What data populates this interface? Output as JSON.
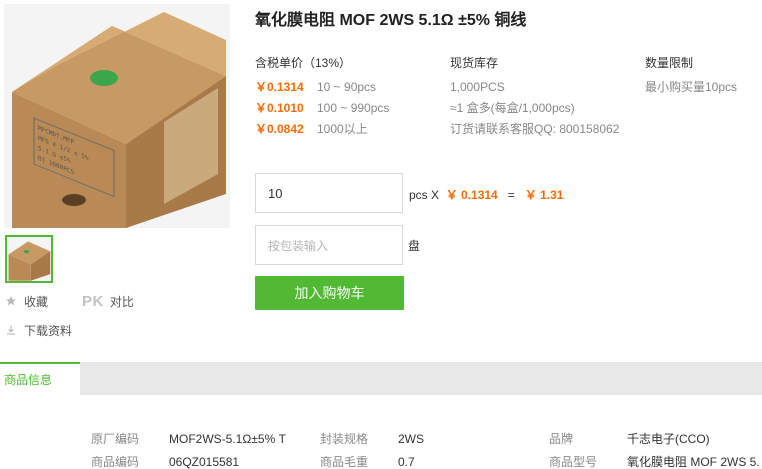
{
  "product": {
    "title": "氧化膜电阻 MOF 2WS 5.1Ω ±5% 铜线"
  },
  "price_col": {
    "header": "含税单价（13%）",
    "tiers": [
      {
        "price": "￥0.1314",
        "range": "10 ~ 90pcs"
      },
      {
        "price": "￥0.1010",
        "range": "100 ~ 990pcs"
      },
      {
        "price": "￥0.0842",
        "range": "1000以上"
      }
    ]
  },
  "stock_col": {
    "header": "现货库存",
    "lines": [
      "1,000PCS",
      "≈1 盒多(每盒/1,000pcs)",
      "订货请联系客服QQ: 800158062"
    ]
  },
  "limit_col": {
    "header": "数量限制",
    "lines": [
      "最小购买量10pcs"
    ]
  },
  "order": {
    "qty_value": "10",
    "unit_x": "pcs X",
    "unit_price": "￥ 0.1314",
    "equals": "=",
    "total": "￥ 1.31",
    "pack_placeholder": "按包装输入",
    "pack_unit": "盘",
    "cart_label": "加入购物车"
  },
  "side": {
    "favorite_label": "收藏",
    "pk_text": "PK",
    "compare_label": "对比",
    "download_label": "下载资料"
  },
  "tabs": {
    "active": "商品信息"
  },
  "specs": {
    "col1": [
      {
        "k": "原厂编码",
        "v": "MOF2WS-5.1Ω±5% T"
      },
      {
        "k": "商品编码",
        "v": "06QZ015581"
      }
    ],
    "col2": [
      {
        "k": "封装规格",
        "v": "2WS"
      },
      {
        "k": "商品毛重",
        "v": "0.7"
      }
    ],
    "col3": [
      {
        "k": "品牌",
        "v": "千志电子(CCO)"
      },
      {
        "k": "商品型号",
        "v": "氧化膜电阻 MOF 2WS 5."
      }
    ]
  },
  "colors": {
    "accent_green": "#52b934",
    "price_orange": "#ff6a00"
  }
}
